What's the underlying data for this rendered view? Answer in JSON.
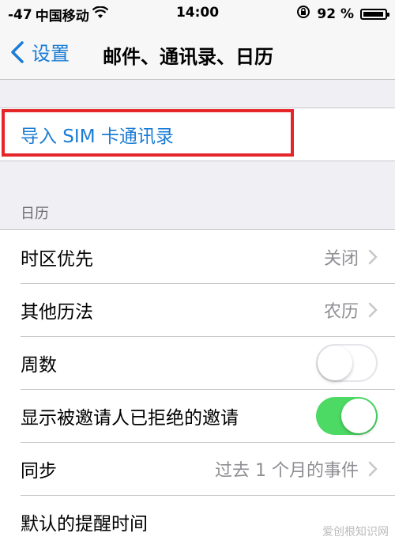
{
  "status_bar": {
    "signal": "-47",
    "carrier": "中国移动",
    "time": "14:00",
    "battery_percent": "92 %",
    "battery_level": 0.92
  },
  "nav": {
    "back_label": "设置",
    "title": "邮件、通讯录、日历"
  },
  "import_sim_label": "导入 SIM 卡通讯录",
  "calendar_section": {
    "header": "日历",
    "rows": [
      {
        "label": "时区优先",
        "value": "关闭"
      },
      {
        "label": "其他历法",
        "value": "农历"
      },
      {
        "label": "周数",
        "switch_on": false
      },
      {
        "label": "显示被邀请人已拒绝的邀请",
        "switch_on": true
      },
      {
        "label": "同步",
        "value": "过去 1 个月的事件"
      },
      {
        "label": "默认的提醒时间"
      }
    ]
  },
  "watermark": "爱创根知识网",
  "colors": {
    "accent": "#1a7cd5",
    "switch_on": "#4cd964",
    "highlight": "#e4262a"
  }
}
